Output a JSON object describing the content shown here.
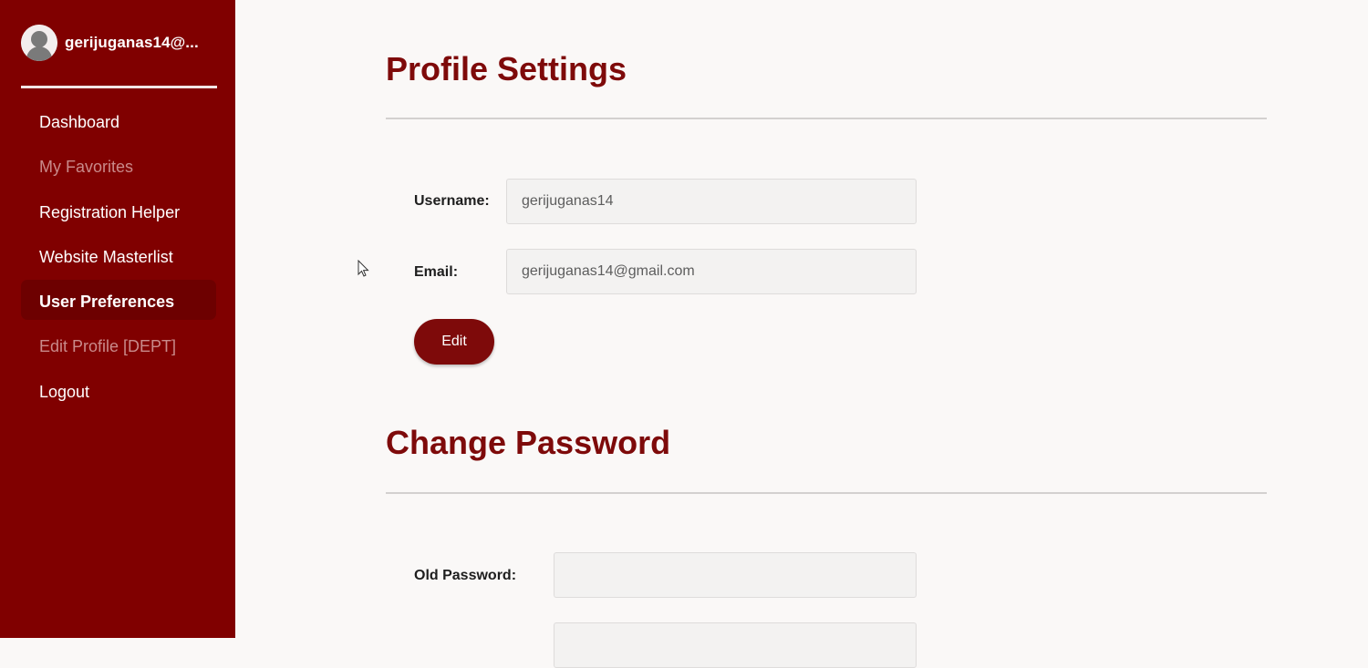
{
  "sidebar": {
    "user_name": "gerijuganas14@...",
    "items": [
      {
        "label": "Dashboard"
      },
      {
        "label": "My Favorites"
      },
      {
        "label": "Registration Helper"
      },
      {
        "label": "Website Masterlist"
      },
      {
        "label": "User Preferences"
      },
      {
        "label": "Edit Profile [DEPT]"
      },
      {
        "label": "Logout"
      }
    ],
    "active_item": "User Preferences",
    "muted_items": [
      "My Favorites",
      "Edit Profile [DEPT]"
    ]
  },
  "profile": {
    "title": "Profile Settings",
    "username_label": "Username:",
    "username_value": "gerijuganas14",
    "email_label": "Email:",
    "email_value": "gerijuganas14@gmail.com",
    "edit_label": "Edit"
  },
  "password": {
    "title": "Change Password",
    "old_password_label": "Old Password:",
    "old_password_value": ""
  },
  "icons": {
    "avatar": "user-avatar-icon",
    "cursor": "mouse-cursor-icon"
  },
  "colors": {
    "sidebar_bg": "#800000",
    "active_item_bg": "#6d0000",
    "accent": "#7e0a0a",
    "page_bg": "#faf8f7",
    "input_bg": "#f3f2f1"
  }
}
